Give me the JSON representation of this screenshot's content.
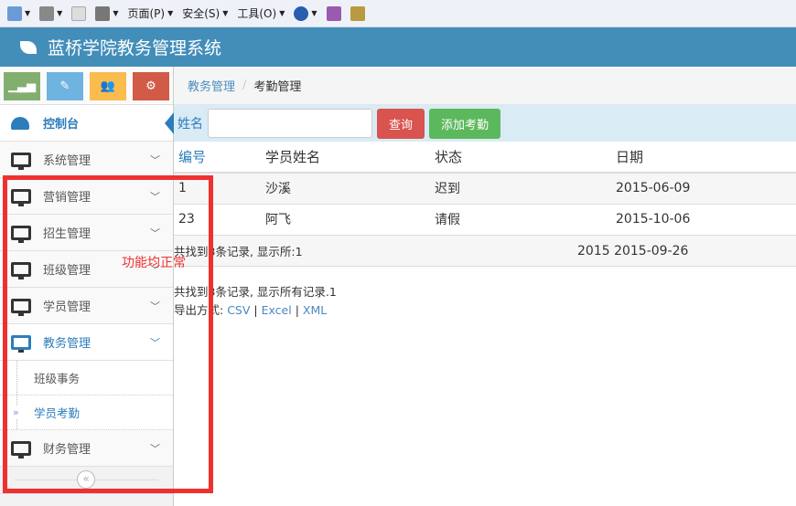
{
  "browser_toolbar": {
    "page": "页面(P)",
    "safety": "安全(S)",
    "tools": "工具(O)"
  },
  "app": {
    "title": "蓝桥学院教务管理系统"
  },
  "sidebar": {
    "dashboard": "控制台",
    "items": [
      "系统管理",
      "营销管理",
      "招生管理",
      "班级管理",
      "学员管理",
      "教务管理"
    ],
    "submenu": [
      "班级事务",
      "学员考勤"
    ],
    "last": "财务管理",
    "collapse": "«"
  },
  "breadcrumb": {
    "parent": "教务管理",
    "sep": "/",
    "current": "考勤管理"
  },
  "search": {
    "label": "姓名",
    "value": "",
    "query_button": "查询",
    "add_button": "添加考勤"
  },
  "table": {
    "headers": [
      "编号",
      "学员姓名",
      "状态",
      "日期"
    ],
    "rows": [
      [
        "1",
        "沙溪",
        "迟到",
        "2015-06-09"
      ],
      [
        "23",
        "阿飞",
        "请假",
        "2015-10-06"
      ],
      [
        "",
        "共找到3条记录, 显示所:1",
        "",
        "2015 2015-09-26"
      ]
    ]
  },
  "footer": {
    "summary": "共找到3条记录, 显示所有记录.1",
    "export_label": "导出方式:",
    "csv": "CSV",
    "excel": "Excel",
    "xml": "XML",
    "sep": "|"
  },
  "annotation": "功能均正常",
  "colors": {
    "header": "#438eb9",
    "danger": "#d15b47",
    "success": "#5cb85c",
    "annotation": "#f03030"
  }
}
